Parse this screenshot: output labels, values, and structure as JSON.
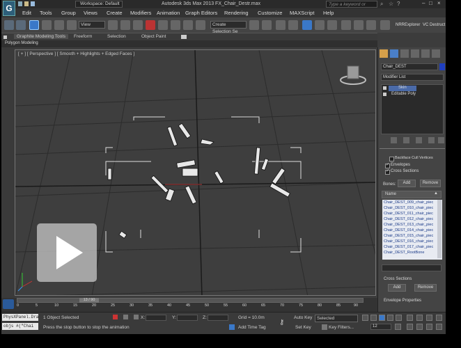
{
  "window": {
    "title": "Autodesk 3ds Max 2013    FX_Chair_Destr.max",
    "workspace": "Workspace: Default",
    "search_placeholder": "Type a keyword or phrase"
  },
  "menu": [
    "Edit",
    "Tools",
    "Group",
    "Views",
    "Create",
    "Modifiers",
    "Animation",
    "Graph Editors",
    "Rendering",
    "Customize",
    "MAXScript",
    "Help"
  ],
  "toolbar": {
    "view_dropdown": "View",
    "selection_set": "Create Selection Se",
    "nrr_explorer": "NRRExplorer",
    "vc_destruct": "VC Destruct"
  },
  "ribbon": {
    "tabs": [
      "Graphite Modeling Tools",
      "Freeform",
      "Selection",
      "Object Paint"
    ],
    "subtab": "Polygon Modeling"
  },
  "viewport": {
    "label": "[ + ] [ Perspective ] [ Smooth + Highlights + Edged Faces ]"
  },
  "command_panel": {
    "object_name": "Chair_DEST",
    "modifier_list": "Modifier List",
    "stack": [
      "Skin",
      "Editable Poly"
    ],
    "backface_cull": "Backface Cull Vertices",
    "envelopes": "Envelopes",
    "cross_sections": "Cross Sections",
    "bones_label": "Bones:",
    "add_label": "Add",
    "remove_label": "Remove",
    "name_header": "Name",
    "bones": [
      "Chair_DEST_009_chair_piec",
      "Chair_DEST_010_chair_piec",
      "Chair_DEST_011_chair_piec",
      "Chair_DEST_012_chair_piec",
      "Chair_DEST_013_chair_piec",
      "Chair_DEST_014_chair_piec",
      "Chair_DEST_015_chair_piec",
      "Chair_DEST_016_chair_piec",
      "Chair_DEST_017_chair_piec",
      "Chair_DEST_RootBone"
    ],
    "cross_sections_header": "Cross Sections",
    "cs_add": "Add",
    "cs_remove": "Remove",
    "envelope_properties": "Envelope Properties"
  },
  "trackbar": {
    "frame_readout": "13 / 90",
    "ticks": [
      "0",
      "5",
      "10",
      "15",
      "20",
      "25",
      "30",
      "35",
      "40",
      "45",
      "50",
      "55",
      "60",
      "65",
      "70",
      "75",
      "80",
      "85",
      "90"
    ]
  },
  "status": {
    "script_line1": "PhysXPanel.Dra",
    "script_line2": "objs #(\"Chai",
    "selection": "1 Object Selected",
    "prompt": "Press the stop button to stop the animation",
    "x_label": "X:",
    "y_label": "Y:",
    "z_label": "Z:",
    "grid": "Grid = 10.0m",
    "add_time_tag": "Add Time Tag",
    "auto_key": "Auto Key",
    "set_key": "Set Key",
    "selected_dropdown": "Selected",
    "key_filters": "Key Filters...",
    "frame_field": "12"
  }
}
